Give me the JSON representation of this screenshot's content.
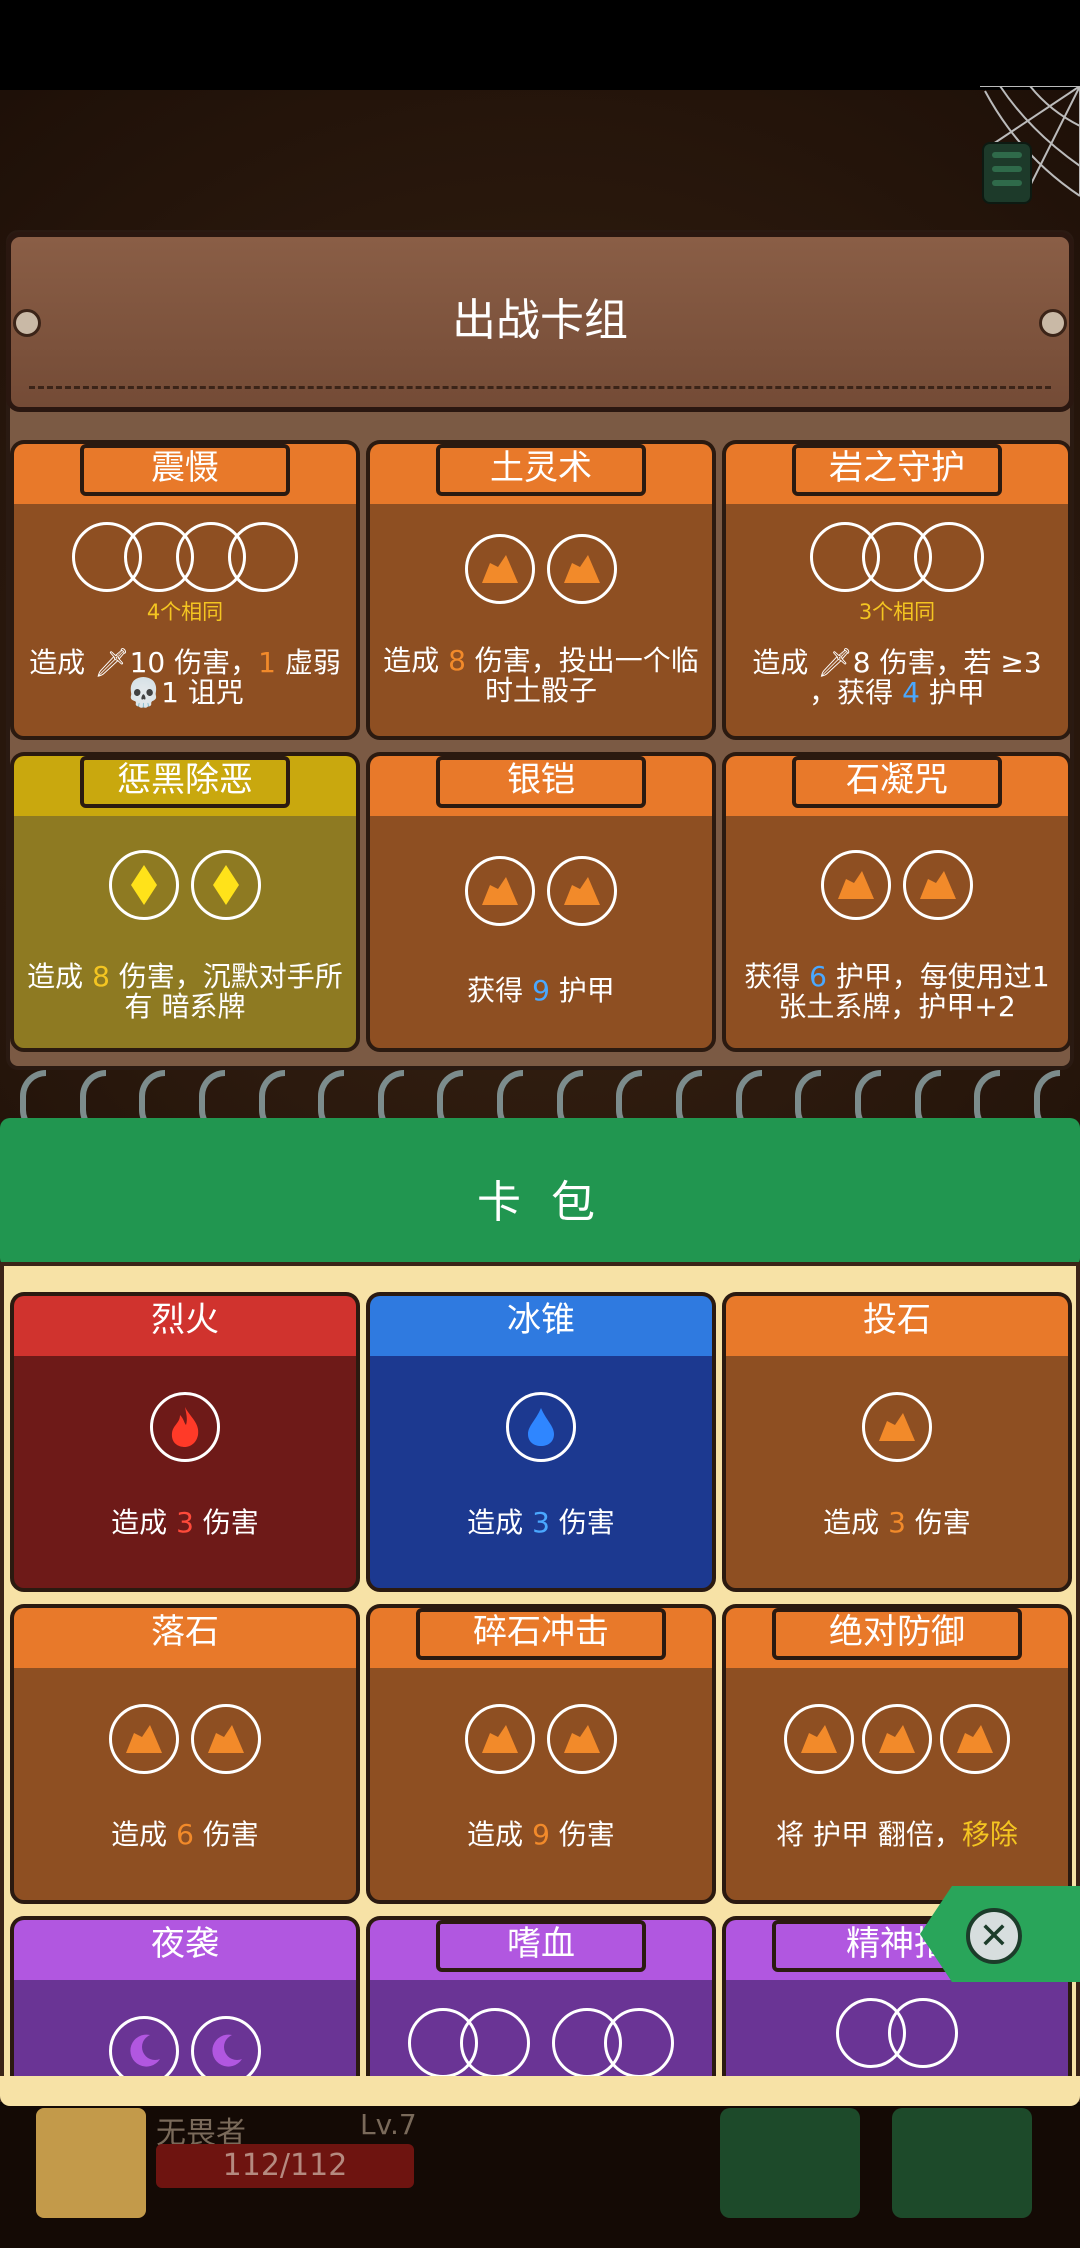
{
  "deck": {
    "title": "出战卡组",
    "cards": [
      {
        "name": "震慑",
        "sub": "4个相同",
        "desc1": "造成 🗡10 伤害，",
        "desc1b": "1",
        "desc1c": " 虚弱",
        "desc2": "💀1 诅咒"
      },
      {
        "name": "土灵术",
        "desc_a": "造成 ",
        "desc_b": "8",
        "desc_c": " 伤害，投出一个临时土骰子"
      },
      {
        "name": "岩之守护",
        "sub": "3个相同",
        "desc_a": "造成 🗡8 伤害，若 ",
        "desc_b": "≥3",
        "desc_c": "，获得 ",
        "desc_d": "4",
        "desc_e": " 护甲"
      },
      {
        "name": "惩黑除恶",
        "desc_a": "造成 ",
        "desc_b": "8",
        "desc_c": " 伤害，沉默对手所有 ",
        "desc_d": "暗系牌"
      },
      {
        "name": "银铠",
        "desc_a": "获得 ",
        "desc_b": "9",
        "desc_c": " 护甲"
      },
      {
        "name": "石凝咒",
        "desc_a": "获得 ",
        "desc_b": "6",
        "desc_c": " 护甲，每使用过1张",
        "desc_d": "土系牌，",
        "desc_e": "护甲+2"
      }
    ]
  },
  "pack": {
    "title": "卡 包",
    "cards": [
      {
        "name": "烈火",
        "desc_a": "造成 ",
        "desc_b": "3",
        "desc_c": " 伤害"
      },
      {
        "name": "冰锥",
        "desc_a": "造成 ",
        "desc_b": "3",
        "desc_c": " 伤害"
      },
      {
        "name": "投石",
        "desc_a": "造成 ",
        "desc_b": "3",
        "desc_c": " 伤害"
      },
      {
        "name": "落石",
        "desc_a": "造成 ",
        "desc_b": "6",
        "desc_c": " 伤害"
      },
      {
        "name": "碎石冲击",
        "desc_a": "造成 ",
        "desc_b": "9",
        "desc_c": " 伤害"
      },
      {
        "name": "绝对防御",
        "desc_a": "将 ",
        "desc_b": "护甲 翻倍，",
        "desc_c": "移除"
      },
      {
        "name": "夜袭"
      },
      {
        "name": "嗜血"
      },
      {
        "name": "精神指"
      }
    ]
  },
  "player": {
    "name": "无畏者",
    "level": "Lv.7",
    "hp": "112/112"
  },
  "icons": {
    "close": "close-icon",
    "menu": "menu-icon"
  }
}
